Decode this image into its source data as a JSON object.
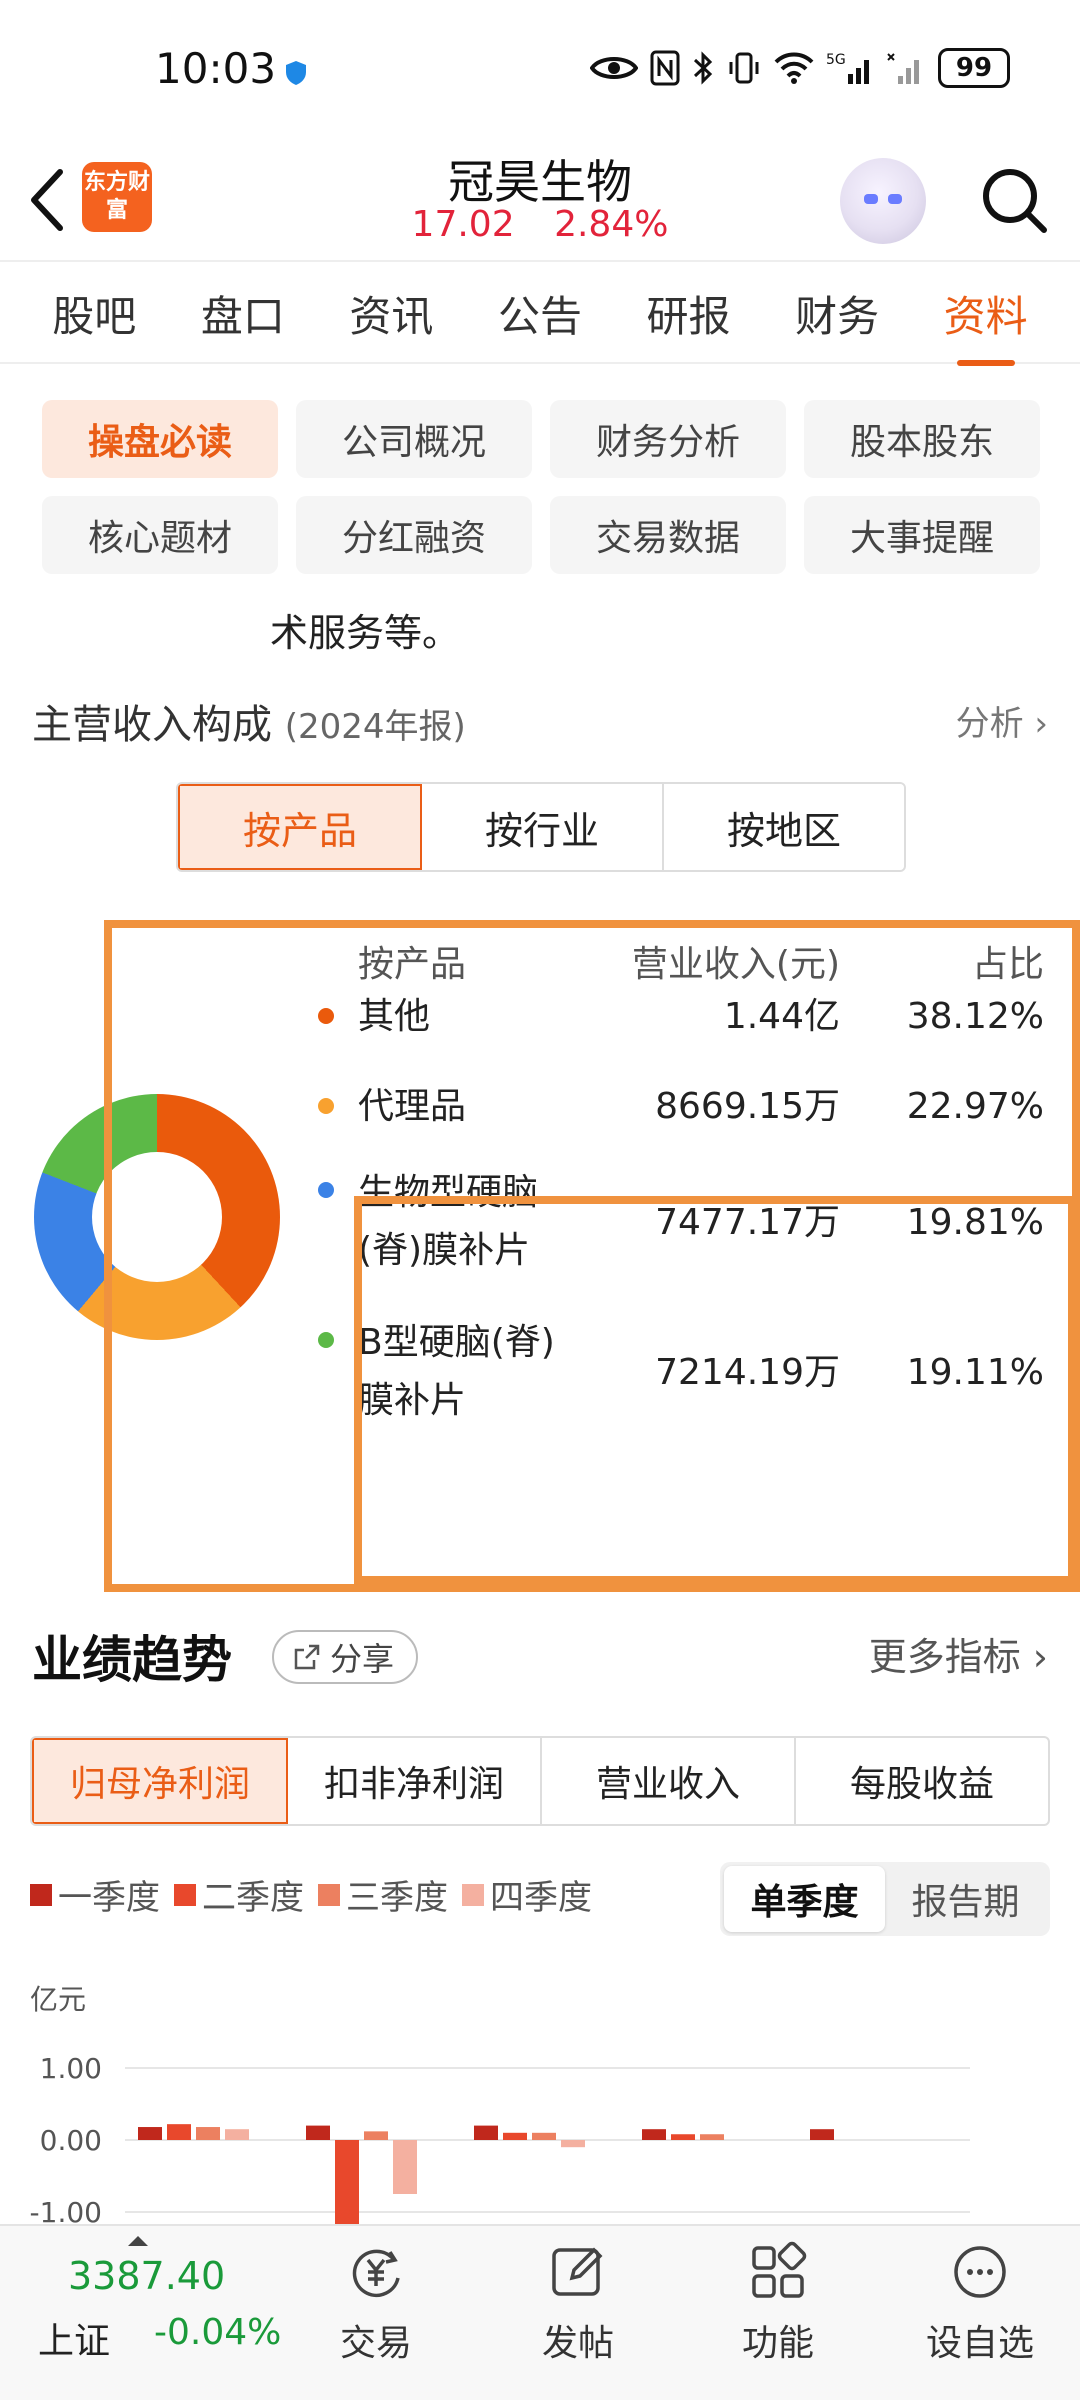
{
  "status_bar": {
    "time": "10:03",
    "network": "5G",
    "battery": "99"
  },
  "header": {
    "stock_name": "冠昊生物",
    "price": "17.02",
    "change_pct": "2.84%",
    "brand_logo_text": "东方财富"
  },
  "main_tabs": [
    {
      "label": "股吧"
    },
    {
      "label": "盘口"
    },
    {
      "label": "资讯"
    },
    {
      "label": "公告"
    },
    {
      "label": "研报"
    },
    {
      "label": "财务"
    },
    {
      "label": "资料"
    }
  ],
  "active_main_tab": "资料",
  "sub_tabs": [
    {
      "label": "操盘必读"
    },
    {
      "label": "公司概况"
    },
    {
      "label": "财务分析"
    },
    {
      "label": "股本股东"
    },
    {
      "label": "核心题材"
    },
    {
      "label": "分红融资"
    },
    {
      "label": "交易数据"
    },
    {
      "label": "大事提醒"
    }
  ],
  "intro_tail": "术服务等。",
  "revenue": {
    "title": "主营收入构成",
    "period": "(2024年报)",
    "analyze_link": "分析",
    "segments": [
      "按产品",
      "按行业",
      "按地区"
    ],
    "table_headers": {
      "name": "按产品",
      "value": "营业收入(元)",
      "pct": "占比"
    },
    "rows": [
      {
        "name": "其他",
        "value": "1.44亿",
        "pct": "38.12%",
        "color": "#ea5a0c"
      },
      {
        "name": "代理品",
        "value": "8669.15万",
        "pct": "22.97%",
        "color": "#f8a12f"
      },
      {
        "name_line1": "生物型硬脑",
        "name_line2": "(脊)膜补片",
        "value": "7477.17万",
        "pct": "19.81%",
        "color": "#3b82e6"
      },
      {
        "name_line1": "B型硬脑(脊)",
        "name_line2": "膜补片",
        "value": "7214.19万",
        "pct": "19.11%",
        "color": "#5cb947"
      }
    ]
  },
  "performance": {
    "title": "业绩趋势",
    "share_label": "分享",
    "more_metrics": "更多指标",
    "metric_tabs": [
      "归母净利润",
      "扣非净利润",
      "营业收入",
      "每股收益"
    ],
    "legend": [
      {
        "label": "一季度",
        "color": "#c0281c"
      },
      {
        "label": "二季度",
        "color": "#e8482c"
      },
      {
        "label": "三季度",
        "color": "#ec8060"
      },
      {
        "label": "四季度",
        "color": "#f4b0a0"
      }
    ],
    "period_toggle": [
      "单季度",
      "报告期"
    ],
    "unit": "亿元"
  },
  "chart_data": {
    "type": "bar",
    "ylabel": "亿元",
    "ylim": [
      -1.0,
      1.0
    ],
    "yticks": [
      "1.00",
      "0.00",
      "-1.00"
    ],
    "groups": 5,
    "series": [
      {
        "name": "一季度",
        "values": [
          0.18,
          0.2,
          0.2,
          0.15,
          0.15
        ]
      },
      {
        "name": "二季度",
        "values": [
          0.22,
          -1.2,
          0.1,
          0.08,
          null
        ]
      },
      {
        "name": "三季度",
        "values": [
          0.18,
          0.12,
          0.1,
          0.08,
          null
        ]
      },
      {
        "name": "四季度",
        "values": [
          0.15,
          -0.75,
          -0.1,
          null,
          null
        ]
      }
    ]
  },
  "bottom_bar": {
    "index_value": "3387.40",
    "index_name": "上证",
    "index_change": "-0.04%",
    "nav": [
      {
        "label": "交易",
        "icon": "trade-icon"
      },
      {
        "label": "发帖",
        "icon": "compose-icon"
      },
      {
        "label": "功能",
        "icon": "apps-icon"
      },
      {
        "label": "设自选",
        "icon": "add-watchlist-icon"
      }
    ]
  }
}
